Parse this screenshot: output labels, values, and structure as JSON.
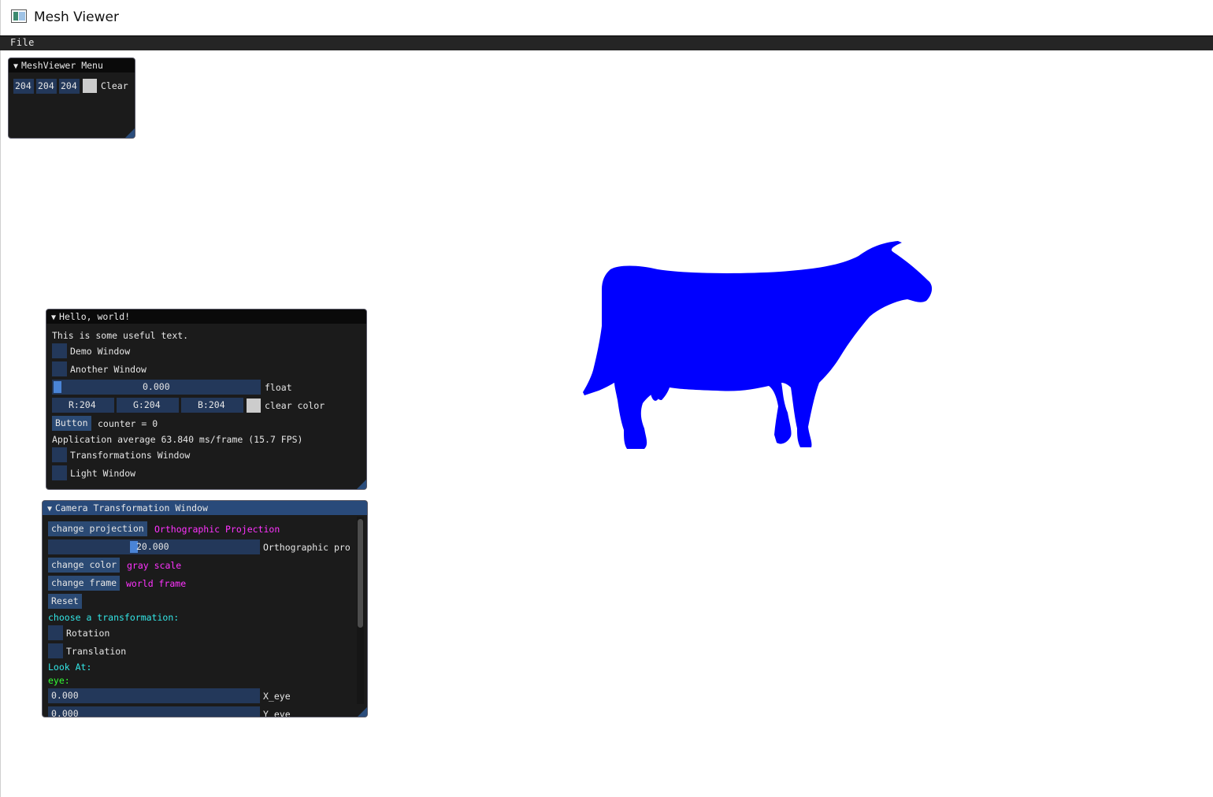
{
  "window": {
    "title": "Mesh Viewer"
  },
  "menubar": {
    "file_label": "File"
  },
  "meshviewer_menu": {
    "title": "MeshViewer Menu",
    "r": "204",
    "g": "204",
    "b": "204",
    "clear_label": "Clear",
    "color": "#cccccc"
  },
  "hello_window": {
    "title": "Hello, world!",
    "useful_text": "This is some useful text.",
    "demo_window_label": "Demo Window",
    "another_window_label": "Another Window",
    "float_value": "0.000",
    "float_label": "float",
    "r_value": "R:204",
    "g_value": "G:204",
    "b_value": "B:204",
    "clear_color_label": "clear color",
    "button_label": "Button",
    "counter_text": "counter = 0",
    "fps_text": "Application average 63.840 ms/frame (15.7 FPS)",
    "transformations_window_label": "Transformations Window",
    "light_window_label": "Light Window"
  },
  "camera_window": {
    "title": "Camera Transformation Window",
    "change_projection_label": "change projection",
    "projection_value": "Orthographic Projection",
    "ortho_value": "20.000",
    "ortho_label": "Orthographic pro",
    "change_color_label": "change color",
    "color_value": "gray scale",
    "change_frame_label": "change frame",
    "frame_value": "world frame",
    "reset_label": "Reset",
    "choose_transformation": "choose a transformation:",
    "rotation_label": "Rotation",
    "translation_label": "Translation",
    "look_at_label": "Look At:",
    "eye_label": "eye:",
    "x_eye_value": "0.000",
    "x_eye_label": "X_eye",
    "y_eye_value": "0.000",
    "y_eye_label": "Y_eye"
  },
  "viewport": {
    "mesh_color": "#0000ff",
    "background": "#ffffff"
  }
}
